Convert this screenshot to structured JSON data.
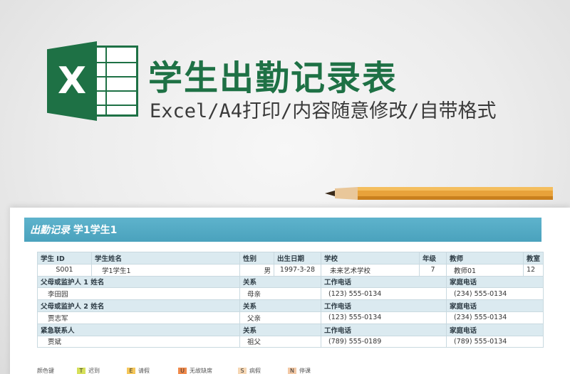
{
  "header": {
    "title": "学生出勤记录表",
    "subtitle": "Excel/A4打印/内容随意修改/自带格式",
    "logo_letter": "X"
  },
  "colors": {
    "brand": "#1e7145",
    "banner": "#4aa2bd",
    "header_fill": "#dbeaf0"
  },
  "sheet": {
    "banner_prefix": "出勤记录",
    "banner_name": "学1学生1",
    "student_headers": [
      "学生 ID",
      "学生姓名",
      "性别",
      "出生日期",
      "学校",
      "年级",
      "教师",
      "教室"
    ],
    "student_values": [
      "S001",
      "学1学生1",
      "男",
      "1997-3-28",
      "未来艺术学校",
      "7",
      "教师01",
      "12"
    ],
    "contact_headers_1": [
      "父母或监护人 1 姓名",
      "关系",
      "工作电话",
      "家庭电话"
    ],
    "contact_values_1": [
      "李田园",
      "母亲",
      "(123) 555-0134",
      "(234) 555-0134"
    ],
    "contact_headers_2": [
      "父母或监护人 2 姓名",
      "关系",
      "工作电话",
      "家庭电话"
    ],
    "contact_values_2": [
      "贾志军",
      "父亲",
      "(123) 555-0134",
      "(234) 555-0134"
    ],
    "contact_headers_3": [
      "紧急联系人",
      "关系",
      "工作电话",
      "家庭电话"
    ],
    "contact_values_3": [
      "贾斌",
      "祖父",
      "(789) 555-0189",
      "(789) 555-0134"
    ]
  },
  "legend": {
    "label": "颜色键",
    "items": [
      {
        "code": "T",
        "label": "迟到",
        "color": "#d6e05a"
      },
      {
        "code": "E",
        "label": "请假",
        "color": "#f5c75a"
      },
      {
        "code": "U",
        "label": "无故缺席",
        "color": "#f08a4b"
      },
      {
        "code": "S",
        "label": "病假",
        "color": "#f6d7b4"
      },
      {
        "code": "N",
        "label": "停课",
        "color": "#f3c9a6"
      }
    ]
  }
}
